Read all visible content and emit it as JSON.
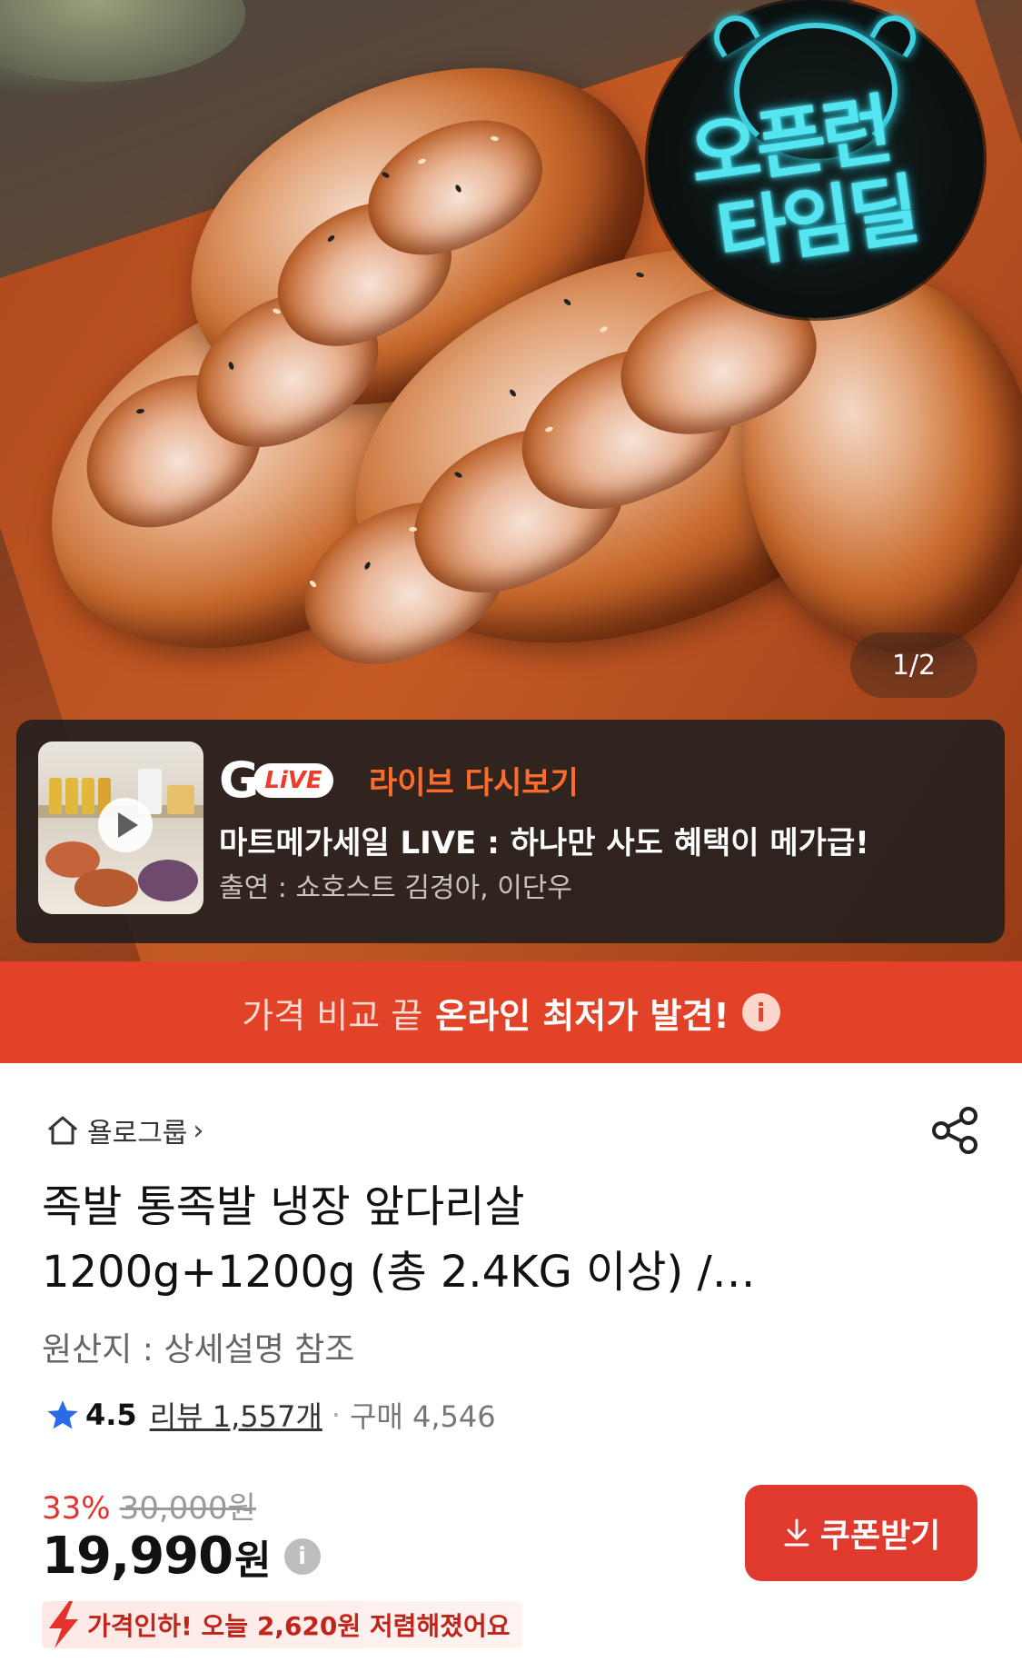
{
  "hero": {
    "badge_line1": "오픈런",
    "badge_line2": "타임딜",
    "pager": "1/2"
  },
  "live": {
    "logo_g": "G",
    "logo_live": "LiVE",
    "replay_label": "라이브 다시보기",
    "title": "마트메가세일 LIVE : 하나만 사도 혜택이 메가급!",
    "cast": "출연 : 쇼호스트 김경아, 이단우"
  },
  "banner": {
    "prefix": "가격 비교 끝",
    "highlight": "온라인 최저가 발견!",
    "info_icon": "i"
  },
  "product": {
    "store": "욜로그룹",
    "title_line1": "족발 통족발 냉장 앞다리살",
    "title_line2": "1200g+1200g (총 2.4KG 이상) /…",
    "origin": "원산지 : 상세설명 참조",
    "rating": "4.5",
    "reviews": "리뷰 1,557개",
    "separator": "·",
    "purchases": "구매 4,546",
    "discount_pct": "33%",
    "original_price": "30,000원",
    "price": "19,990",
    "price_unit": "원",
    "price_info_icon": "i",
    "coupon_button": "쿠폰받기",
    "price_drop": "가격인하! 오늘 2,620원 저렴해졌어요"
  },
  "colors": {
    "accent_red": "#e24328",
    "coupon_red": "#e0392d",
    "neon_cyan": "#55e5f0",
    "live_orange": "#ff6b2c",
    "star_blue": "#2a6ae8"
  },
  "icons": [
    "home-icon",
    "chevron-right-icon",
    "share-icon",
    "star-icon",
    "download-icon",
    "lightning-icon",
    "info-icon",
    "play-icon",
    "alarm-clock-icon"
  ]
}
